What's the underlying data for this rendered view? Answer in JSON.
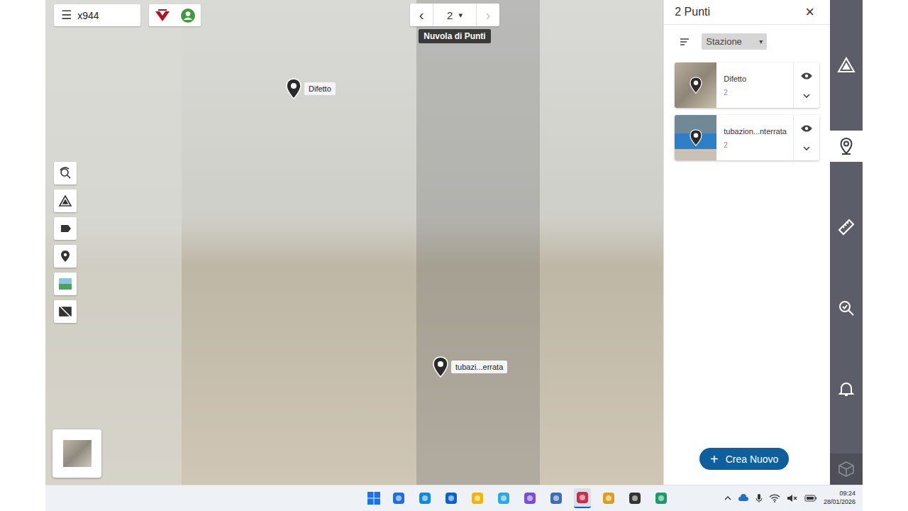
{
  "viewer": {
    "menu_icon": "☰",
    "project": "x944",
    "station": {
      "prev": "‹",
      "value": "2",
      "dropdown": "▾",
      "next": "›",
      "next_disabled": true
    },
    "tooltip": "Nuvola di Punti"
  },
  "pins": [
    {
      "label": "Difetto"
    },
    {
      "label": "tubazi...errata"
    }
  ],
  "panel": {
    "title": "2 Punti",
    "close": "×",
    "sort_field": "Stazione",
    "dropdown": "▾",
    "items": [
      {
        "name": "Difetto",
        "count": "2",
        "visible": true
      },
      {
        "name": "tubazion...nterrata",
        "count": "2",
        "visible": true
      }
    ],
    "create_icon": "+",
    "create_button": "Crea Nuovo"
  },
  "rail": [
    {
      "selected": false
    },
    {
      "selected": true
    },
    {
      "selected": false
    },
    {
      "selected": false
    },
    {
      "selected": false
    }
  ],
  "taskbar": {
    "apps": [
      {
        "active": false
      },
      {
        "active": false
      },
      {
        "active": false
      },
      {
        "active": false
      },
      {
        "active": false
      },
      {
        "active": false
      },
      {
        "active": false
      },
      {
        "active": true
      },
      {
        "active": false
      },
      {
        "active": false
      },
      {
        "active": false
      }
    ],
    "time": "09:24",
    "date": "28/01/2026"
  }
}
